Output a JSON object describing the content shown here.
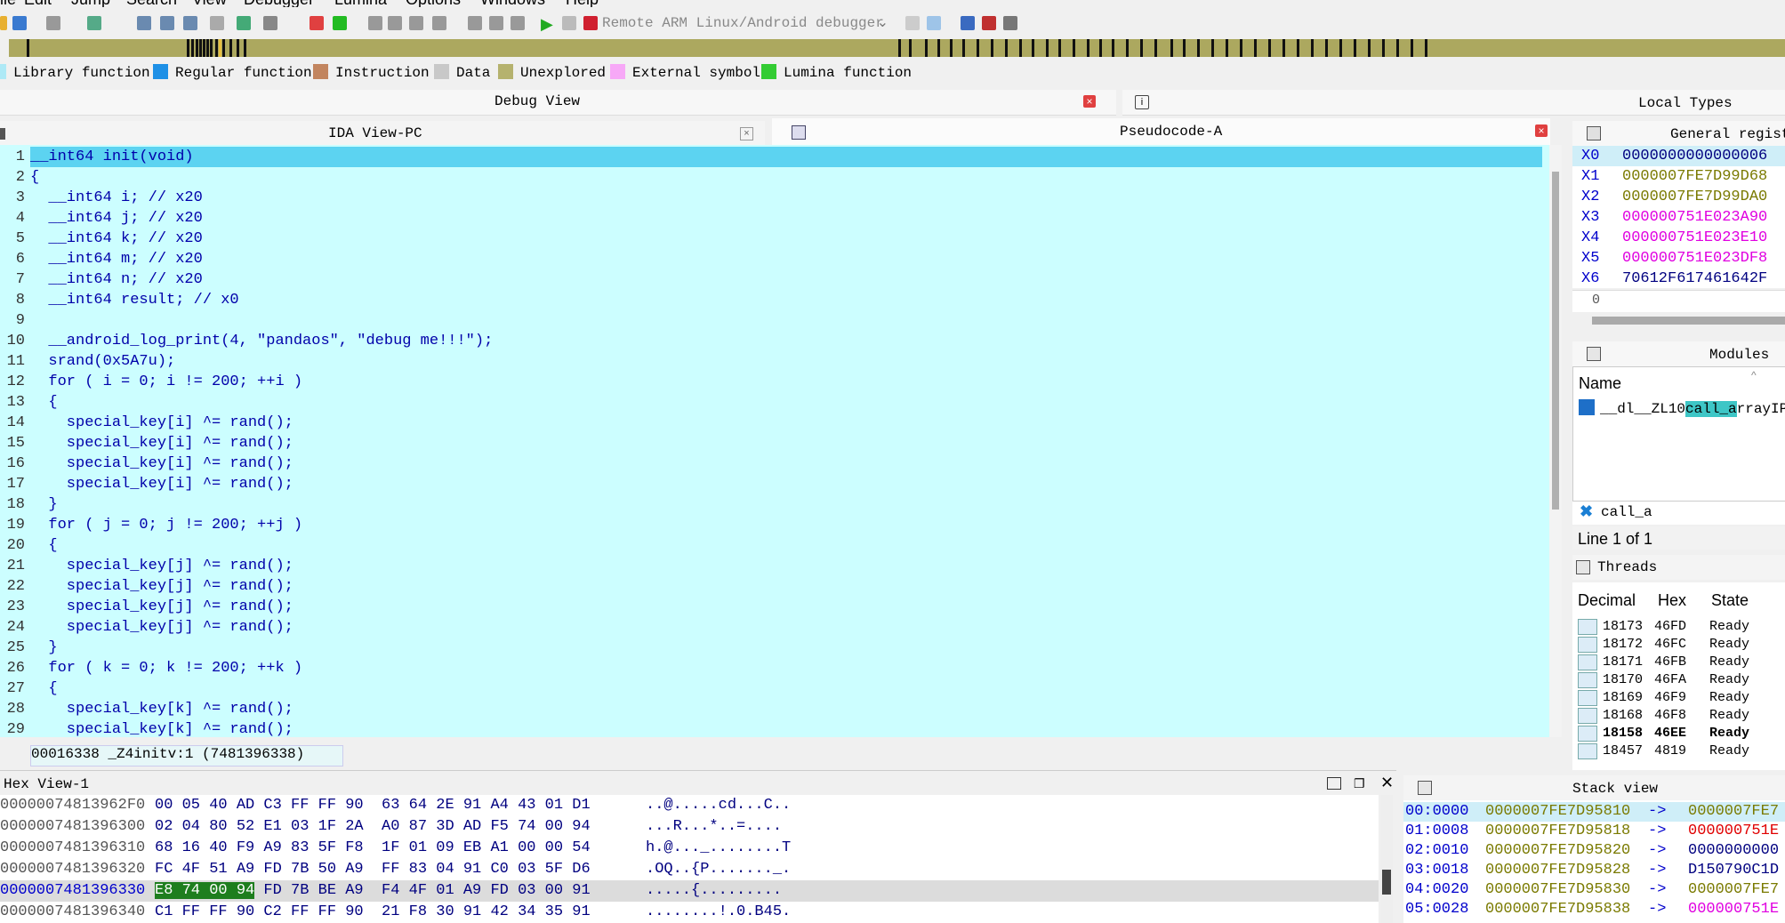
{
  "menu": [
    "ile",
    "Edit",
    "Jump",
    "Search",
    "View",
    "Debugger",
    "Lumina",
    "Options",
    "Windows",
    "Help"
  ],
  "toolbar": {
    "debugger_select": "Remote ARM Linux/Android debugger"
  },
  "legend": [
    {
      "label": "Library function",
      "color": "#aee9f6"
    },
    {
      "label": "Regular function",
      "color": "#1e90e6"
    },
    {
      "label": "Instruction",
      "color": "#c2855f"
    },
    {
      "label": "Data",
      "color": "#c8c8c8"
    },
    {
      "label": "Unexplored",
      "color": "#b5b26e"
    },
    {
      "label": "External symbol",
      "color": "#f7a8f7"
    },
    {
      "label": "Lumina function",
      "color": "#33cc33"
    }
  ],
  "debug_view": {
    "title": "Debug View"
  },
  "local_types": {
    "title": "Local Types"
  },
  "tabs": {
    "ida_view": "IDA View-PC",
    "pseudocode": "Pseudocode-A"
  },
  "code_lines": [
    {
      "n": "1",
      "text": "__int64 init(void)"
    },
    {
      "n": "2",
      "text": "{"
    },
    {
      "n": "3",
      "text": "  __int64 i; // x20"
    },
    {
      "n": "4",
      "text": "  __int64 j; // x20"
    },
    {
      "n": "5",
      "text": "  __int64 k; // x20"
    },
    {
      "n": "6",
      "text": "  __int64 m; // x20"
    },
    {
      "n": "7",
      "text": "  __int64 n; // x20"
    },
    {
      "n": "8",
      "text": "  __int64 result; // x0"
    },
    {
      "n": "9",
      "text": ""
    },
    {
      "n": "10",
      "text": "  __android_log_print(4, \"pandaos\", \"debug me!!!\");"
    },
    {
      "n": "11",
      "text": "  srand(0x5A7u);"
    },
    {
      "n": "12",
      "text": "  for ( i = 0; i != 200; ++i )"
    },
    {
      "n": "13",
      "text": "  {"
    },
    {
      "n": "14",
      "text": "    special_key[i] ^= rand();"
    },
    {
      "n": "15",
      "text": "    special_key[i] ^= rand();"
    },
    {
      "n": "16",
      "text": "    special_key[i] ^= rand();"
    },
    {
      "n": "17",
      "text": "    special_key[i] ^= rand();"
    },
    {
      "n": "18",
      "text": "  }"
    },
    {
      "n": "19",
      "text": "  for ( j = 0; j != 200; ++j )"
    },
    {
      "n": "20",
      "text": "  {"
    },
    {
      "n": "21",
      "text": "    special_key[j] ^= rand();"
    },
    {
      "n": "22",
      "text": "    special_key[j] ^= rand();"
    },
    {
      "n": "23",
      "text": "    special_key[j] ^= rand();"
    },
    {
      "n": "24",
      "text": "    special_key[j] ^= rand();"
    },
    {
      "n": "25",
      "text": "  }"
    },
    {
      "n": "26",
      "text": "  for ( k = 0; k != 200; ++k )"
    },
    {
      "n": "27",
      "text": "  {"
    },
    {
      "n": "28",
      "text": "    special_key[k] ^= rand();"
    },
    {
      "n": "29",
      "text": "    special_key[k] ^= rand();"
    }
  ],
  "status_line": "00016338 _Z4initv:1 (7481396338)",
  "registers": {
    "title": "General registe",
    "rows": [
      {
        "name": "X0",
        "value": "0000000000000006",
        "color": "#000080"
      },
      {
        "name": "X1",
        "value": "0000007FE7D99D68",
        "color": "#7a7a00"
      },
      {
        "name": "X2",
        "value": "0000007FE7D99DA0",
        "color": "#7a7a00"
      },
      {
        "name": "X3",
        "value": "000000751E023A90",
        "color": "#e000e0"
      },
      {
        "name": "X4",
        "value": "000000751E023E10",
        "color": "#e000e0"
      },
      {
        "name": "X5",
        "value": "000000751E023DF8",
        "color": "#e000e0"
      },
      {
        "name": "X6",
        "value": "70612F617461642F",
        "color": "#000080"
      }
    ],
    "footer": "0"
  },
  "modules": {
    "title": "Modules",
    "header": "Name",
    "row_prefix": "__dl__ZL10",
    "row_match": "call_a",
    "row_suffix": "rrayIPF",
    "search": "call_a",
    "line_info": "Line 1 of 1"
  },
  "threads": {
    "title": "Threads",
    "headers": {
      "decimal": "Decimal",
      "hex": "Hex",
      "state": "State"
    },
    "rows": [
      {
        "dec": "18173",
        "hex": "46FD",
        "state": "Ready",
        "bold": false
      },
      {
        "dec": "18172",
        "hex": "46FC",
        "state": "Ready",
        "bold": false
      },
      {
        "dec": "18171",
        "hex": "46FB",
        "state": "Ready",
        "bold": false
      },
      {
        "dec": "18170",
        "hex": "46FA",
        "state": "Ready",
        "bold": false
      },
      {
        "dec": "18169",
        "hex": "46F9",
        "state": "Ready",
        "bold": false
      },
      {
        "dec": "18168",
        "hex": "46F8",
        "state": "Ready",
        "bold": false
      },
      {
        "dec": "18158",
        "hex": "46EE",
        "state": "Ready",
        "bold": true
      },
      {
        "dec": "18457",
        "hex": "4819",
        "state": "Ready",
        "bold": false
      }
    ]
  },
  "hex_view": {
    "title": "Hex View-1",
    "rows": [
      {
        "addr": "00000074813962F0",
        "bytes": "00 05 40 AD C3 FF FF 90  63 64 2E 91 A4 43 01 D1",
        "ascii": "..@.....cd...C..",
        "hl": false
      },
      {
        "addr": "0000007481396300",
        "bytes": "02 04 80 52 E1 03 1F 2A  A0 87 3D AD F5 74 00 94",
        "ascii": "...R...*..=....",
        "hl": false
      },
      {
        "addr": "0000007481396310",
        "bytes": "68 16 40 F9 A9 83 5F F8  1F 01 09 EB A1 00 00 54",
        "ascii": "h.@..._........T",
        "hl": false
      },
      {
        "addr": "0000007481396320",
        "bytes": "FC 4F 51 A9 FD 7B 50 A9  FF 83 04 91 C0 03 5F D6",
        "ascii": ".OQ..{P......._.",
        "hl": false
      },
      {
        "addr": "0000007481396330",
        "bytes_hl": "E8 74 00 94",
        "bytes": " FD 7B BE A9  F4 4F 01 A9 FD 03 00 91",
        "ascii": ".....{.........",
        "hl": true
      },
      {
        "addr": "0000007481396340",
        "bytes": "C1 FF FF 90 C2 FF FF 90  21 F8 30 91 42 34 35 91",
        "ascii": "........!.0.B45.",
        "hl": false
      }
    ]
  },
  "stack_view": {
    "title": "Stack view",
    "rows": [
      {
        "off": "00:0000",
        "addr": "0000007FE7D95810",
        "arrow": "->",
        "val": "0000007FE7",
        "color": "#7a7a00"
      },
      {
        "off": "01:0008",
        "addr": "0000007FE7D95818",
        "arrow": "->",
        "val": "000000751E",
        "color": "#e00000"
      },
      {
        "off": "02:0010",
        "addr": "0000007FE7D95820",
        "arrow": "->",
        "val": "0000000000",
        "color": "#000080"
      },
      {
        "off": "03:0018",
        "addr": "0000007FE7D95828",
        "arrow": "->",
        "val": "D150790C1D",
        "color": "#000080"
      },
      {
        "off": "04:0020",
        "addr": "0000007FE7D95830",
        "arrow": "->",
        "val": "0000007FE7",
        "color": "#7a7a00"
      },
      {
        "off": "05:0028",
        "addr": "0000007FE7D95838",
        "arrow": "->",
        "val": "000000751E",
        "color": "#e000e0"
      }
    ]
  }
}
